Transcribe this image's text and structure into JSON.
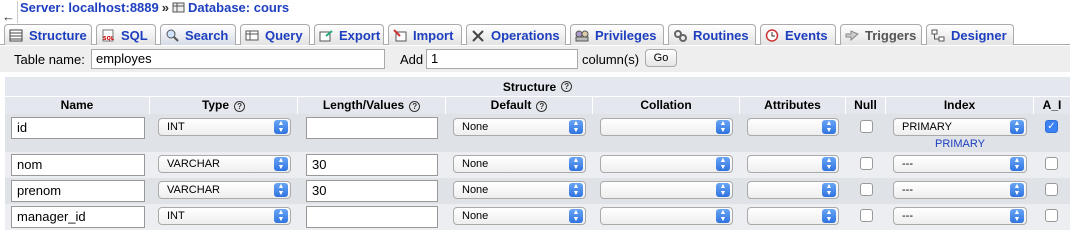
{
  "breadcrumb": {
    "back_glyph": "←",
    "server": "Server: localhost:8889",
    "separator": "»",
    "database": "Database: cours"
  },
  "tabs": [
    {
      "label": "Structure",
      "icon": "structure-icon"
    },
    {
      "label": "SQL",
      "icon": "sql-icon"
    },
    {
      "label": "Search",
      "icon": "search-icon"
    },
    {
      "label": "Query",
      "icon": "query-icon"
    },
    {
      "label": "Export",
      "icon": "export-icon"
    },
    {
      "label": "Import",
      "icon": "import-icon"
    },
    {
      "label": "Operations",
      "icon": "operations-icon"
    },
    {
      "label": "Privileges",
      "icon": "privileges-icon"
    },
    {
      "label": "Routines",
      "icon": "routines-icon"
    },
    {
      "label": "Events",
      "icon": "events-icon"
    },
    {
      "label": "Triggers",
      "icon": "triggers-icon"
    },
    {
      "label": "Designer",
      "icon": "designer-icon"
    }
  ],
  "table_name": {
    "label": "Table name:",
    "value": "employes",
    "add_label": "Add",
    "add_value": "1",
    "columns_label": "column(s)",
    "go_label": "Go"
  },
  "structure": {
    "title": "Structure",
    "help_glyph": "?",
    "headers": {
      "name": "Name",
      "type": "Type",
      "length": "Length/Values",
      "default": "Default",
      "collation": "Collation",
      "attributes": "Attributes",
      "null": "Null",
      "index": "Index",
      "ai": "A_I"
    },
    "rows": [
      {
        "name": "id",
        "type": "INT",
        "length": "",
        "default": "None",
        "collation": "",
        "attributes": "",
        "null": false,
        "index": "PRIMARY",
        "index_link": "PRIMARY",
        "ai": true
      },
      {
        "name": "nom",
        "type": "VARCHAR",
        "length": "30",
        "default": "None",
        "collation": "",
        "attributes": "",
        "null": false,
        "index": "---",
        "index_link": "",
        "ai": false
      },
      {
        "name": "prenom",
        "type": "VARCHAR",
        "length": "30",
        "default": "None",
        "collation": "",
        "attributes": "",
        "null": false,
        "index": "---",
        "index_link": "",
        "ai": false
      },
      {
        "name": "manager_id",
        "type": "INT",
        "length": "",
        "default": "None",
        "collation": "",
        "attributes": "",
        "null": false,
        "index": "---",
        "index_link": "",
        "ai": false
      }
    ]
  },
  "colors": {
    "link": "#1d3fbf",
    "header_bg": "#e4e8ee",
    "row_odd": "#dfe2e7",
    "row_even": "#eceef1",
    "select_arrow": "#2f73e0",
    "checkbox_on": "#3c82f5"
  }
}
